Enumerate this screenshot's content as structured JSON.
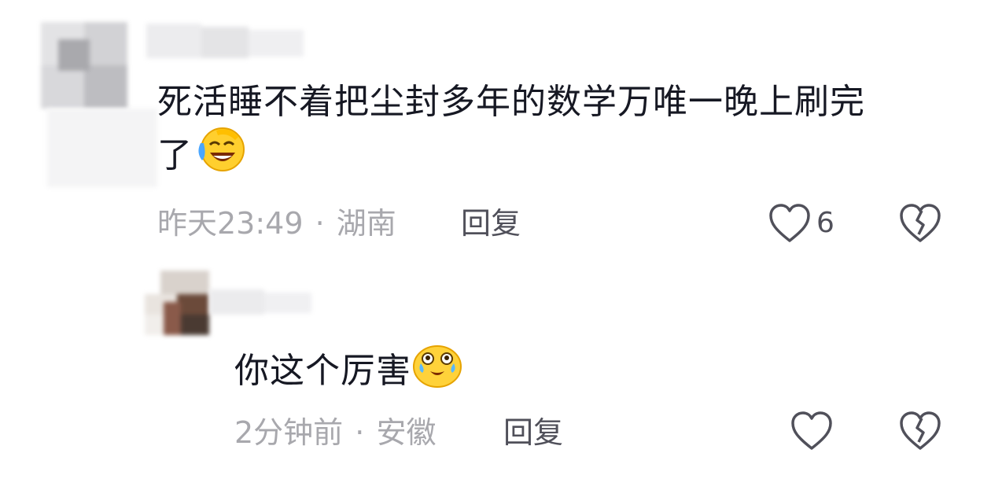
{
  "comment": {
    "text_line1": "死活睡不着把尘封多年的数学万唯一晚上刷完",
    "text_line2": "了",
    "emoji": "laugh-cry-emoji",
    "time": "昨天23:49",
    "separator": "·",
    "location": "湖南",
    "reply_label": "回复",
    "like_count": "6"
  },
  "reply_comment": {
    "text": "你这个厉害",
    "emoji": "tearful-emoji",
    "time": "2分钟前",
    "separator": "·",
    "location": "安徽",
    "reply_label": "回复"
  }
}
